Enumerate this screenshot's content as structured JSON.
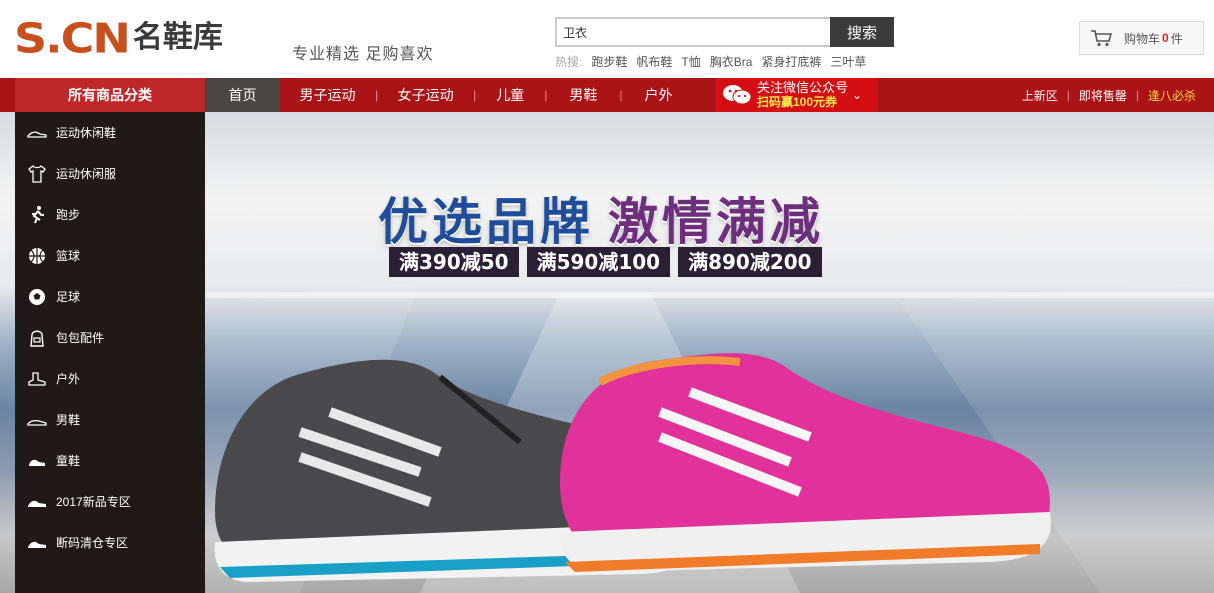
{
  "header": {
    "logo_latin": "S.CN",
    "logo_cn": "名鞋库",
    "slogan": "专业精选 足购喜欢",
    "search": {
      "value": "卫衣",
      "button": "搜索"
    },
    "hot": {
      "label": "热搜:",
      "items": [
        "跑步鞋",
        "帆布鞋",
        "T恤",
        "胸衣Bra",
        "紧身打底裤",
        "三叶草"
      ]
    },
    "cart": {
      "label": "购物车",
      "count": "0",
      "unit": "件",
      "icon": "cart-icon"
    }
  },
  "nav": {
    "all_categories": "所有商品分类",
    "items": [
      "首页",
      "男子运动",
      "女子运动",
      "儿童",
      "男鞋",
      "户外"
    ],
    "active_index": 0,
    "wechat": {
      "line1": "关注微信公众号",
      "line2": "扫码赢100元券",
      "icon": "wechat-icon"
    },
    "right_links": [
      "上新区",
      "即将售罄",
      "逢八必杀"
    ]
  },
  "sidebar": {
    "categories": [
      {
        "label": "运动休闲鞋",
        "icon": "sneaker-icon"
      },
      {
        "label": "运动休闲服",
        "icon": "tshirt-icon"
      },
      {
        "label": "跑步",
        "icon": "runner-icon"
      },
      {
        "label": "篮球",
        "icon": "basketball-icon"
      },
      {
        "label": "足球",
        "icon": "football-icon"
      },
      {
        "label": "包包配件",
        "icon": "bag-icon"
      },
      {
        "label": "户外",
        "icon": "boot-icon"
      },
      {
        "label": "男鞋",
        "icon": "loafer-icon"
      },
      {
        "label": "童鞋",
        "icon": "kids-shoe-icon"
      },
      {
        "label": "2017新品专区",
        "icon": "new-shoe-icon"
      },
      {
        "label": "断码清仓专区",
        "icon": "clearance-shoe-icon"
      }
    ]
  },
  "banner": {
    "title_part1": "优选品牌",
    "title_part2": "激情满减",
    "promos": [
      "满390减50",
      "满590减100",
      "满890减200"
    ],
    "colors": {
      "shoe_left": "#4a4a4c",
      "shoe_right": "#e0329a",
      "accent_blue": "#1f4d9a"
    }
  },
  "colors": {
    "brand_red": "#ab1417",
    "logo_orange": "#c8501f",
    "sidebar_bg": "#1f1a17"
  }
}
